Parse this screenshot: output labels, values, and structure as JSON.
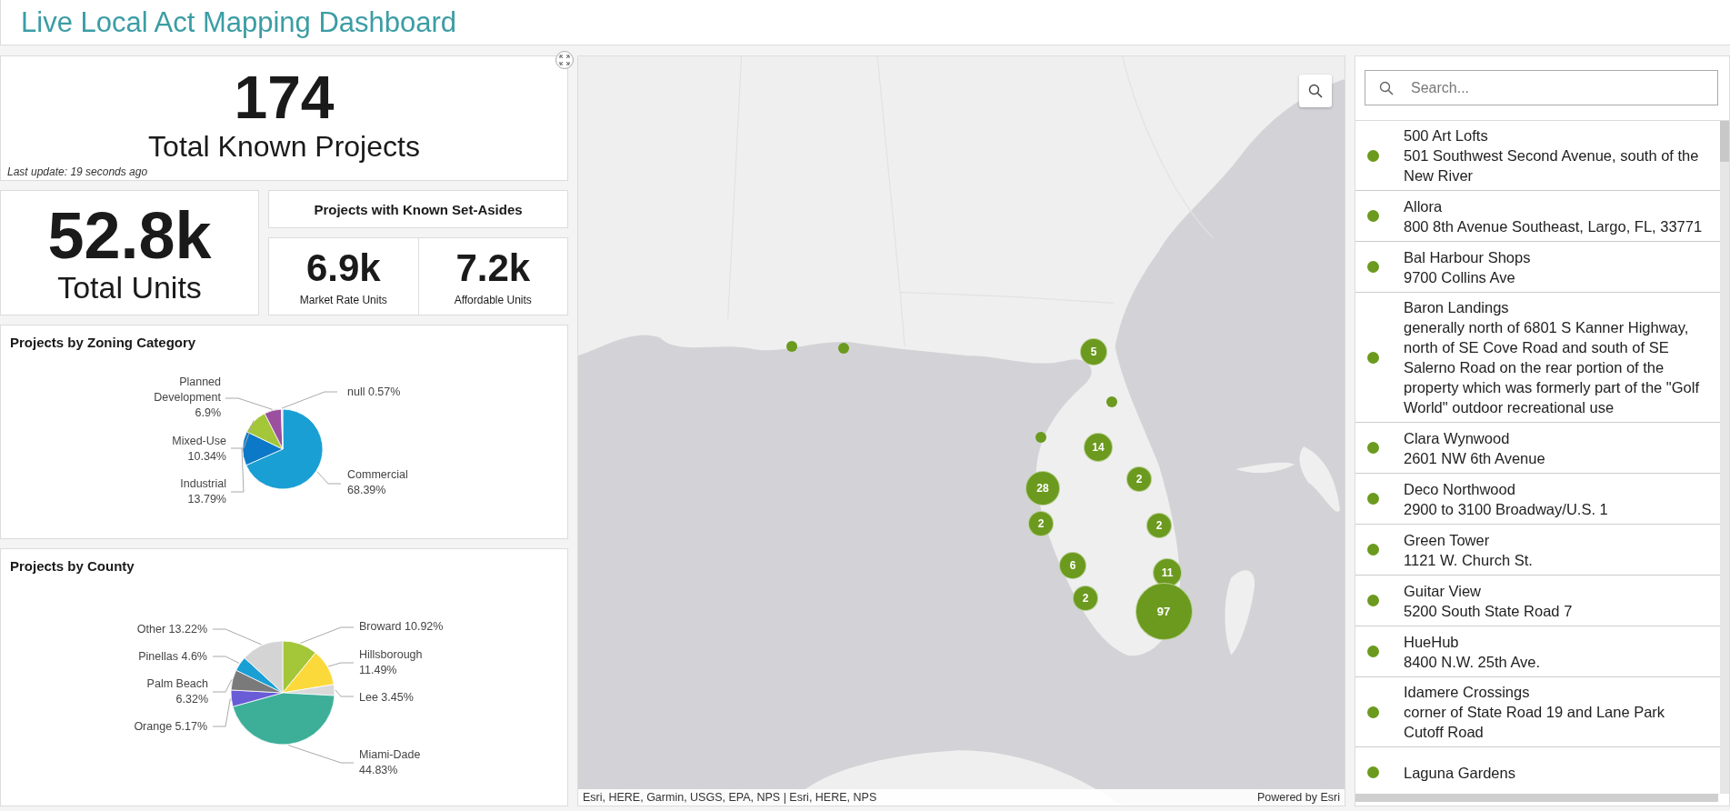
{
  "header": {
    "title": "Live Local Act Mapping Dashboard"
  },
  "indicators": {
    "projects": {
      "value": "174",
      "label": "Total Known Projects",
      "note": "Last update: 19 seconds ago"
    },
    "units": {
      "value": "52.8k",
      "label": "Total Units"
    },
    "set_asides": {
      "title": "Projects with Known Set-Asides",
      "items": [
        {
          "value": "6.9k",
          "label": "Market Rate Units"
        },
        {
          "value": "7.2k",
          "label": "Affordable Units"
        }
      ]
    }
  },
  "charts": [
    {
      "title": "Projects by Zoning Category",
      "chart_data": {
        "type": "pie",
        "categories": [
          "Commercial",
          "Industrial",
          "Mixed-Use",
          "Planned Development",
          "null"
        ],
        "values": [
          68.39,
          13.79,
          10.34,
          6.9,
          0.57
        ],
        "colors": [
          "#1a9fd4",
          "#0b78c8",
          "#a4c639",
          "#9b4f9f",
          "#dcdcdc"
        ],
        "value_labels": [
          "68.39%",
          "13.79%",
          "10.34%",
          "6.9%",
          "0.57%"
        ]
      }
    },
    {
      "title": "Projects by County",
      "chart_data": {
        "type": "pie",
        "categories": [
          "Broward",
          "Hillsborough",
          "Lee",
          "Miami-Dade",
          "Orange",
          "Palm Beach",
          "Pinellas",
          "Other"
        ],
        "values": [
          10.92,
          11.49,
          3.45,
          44.83,
          5.17,
          6.32,
          4.6,
          13.22
        ],
        "colors": [
          "#a4c639",
          "#fcd93b",
          "#d9d9d9",
          "#3daf98",
          "#6a5bd6",
          "#7a7a7a",
          "#1a9fd4",
          "#d4d4d4"
        ],
        "value_labels": [
          "10.92%",
          "11.49%",
          "3.45%",
          "44.83%",
          "5.17%",
          "6.32%",
          "4.6%",
          "13.22%"
        ]
      }
    }
  ],
  "map": {
    "markers": [
      {
        "kind": "point"
      },
      {
        "kind": "point"
      },
      {
        "kind": "cluster",
        "count": "5"
      },
      {
        "kind": "point"
      },
      {
        "kind": "point"
      },
      {
        "kind": "cluster",
        "count": "14"
      },
      {
        "kind": "cluster",
        "count": "2"
      },
      {
        "kind": "cluster",
        "count": "28"
      },
      {
        "kind": "cluster",
        "count": "2"
      },
      {
        "kind": "cluster",
        "count": "2"
      },
      {
        "kind": "cluster",
        "count": "6"
      },
      {
        "kind": "cluster",
        "count": "11"
      },
      {
        "kind": "cluster",
        "count": "2"
      },
      {
        "kind": "cluster",
        "count": "97"
      }
    ],
    "attribution": "Esri, HERE, Garmin, USGS, EPA, NPS | Esri, HERE, NPS",
    "powered_by": "Powered by Esri"
  },
  "list": {
    "search": {
      "placeholder": "Search..."
    },
    "items": [
      {
        "name": "500 Art Lofts",
        "address": "501 Southwest Second Avenue, south of the New River"
      },
      {
        "name": "Allora",
        "address": "800 8th Avenue Southeast, Largo, FL, 33771"
      },
      {
        "name": "Bal Harbour Shops",
        "address": "9700 Collins Ave"
      },
      {
        "name": "Baron Landings",
        "address": "generally north of 6801 S Kanner Highway, north of SE Cove Road and south of SE Salerno Road on the rear portion of the property which was formerly part of the \"Golf World\" outdoor recreational use"
      },
      {
        "name": "Clara Wynwood",
        "address": "2601 NW 6th Avenue"
      },
      {
        "name": "Deco Northwood",
        "address": "2900 to 3100 Broadway/U.S. 1"
      },
      {
        "name": "Green Tower",
        "address": "1121 W. Church St."
      },
      {
        "name": "Guitar View",
        "address": "5200 South State Road 7"
      },
      {
        "name": "HueHub",
        "address": "8400 N.W. 25th Ave."
      },
      {
        "name": "Idamere Crossings",
        "address": "corner of State Road 19 and Lane Park Cutoff Road"
      },
      {
        "name": "Laguna Gardens"
      }
    ]
  }
}
